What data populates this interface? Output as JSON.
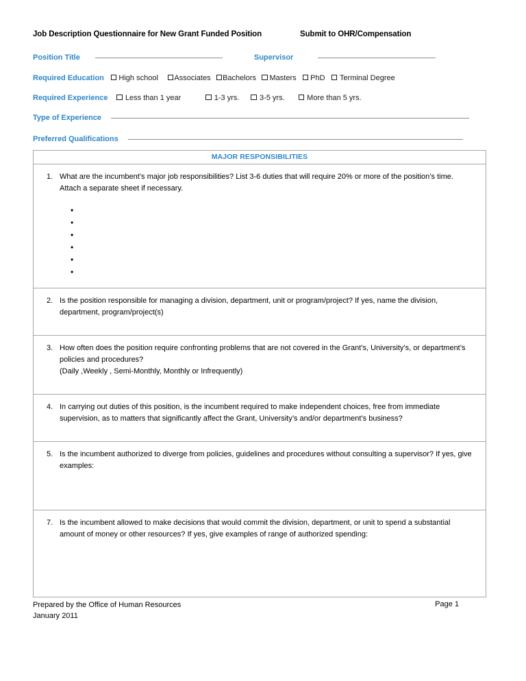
{
  "header": {
    "title": "Job Description Questionnaire for New Grant Funded Position",
    "submit_to": "Submit to OHR/Compensation"
  },
  "colors": {
    "label_blue": "#2E86C8",
    "table_border": "#a6a6a6",
    "rule_gray": "#8d8d8d"
  },
  "fields": {
    "position_title_label": "Position Title",
    "position_title_value": "",
    "supervisor_label": "Supervisor",
    "supervisor_value": "",
    "type_of_experience_label": "Type of Experience",
    "type_of_experience_value": "",
    "preferred_qualifications_label": "Preferred Qualifications",
    "preferred_qualifications_value": ""
  },
  "required_education": {
    "label": "Required Education",
    "options": [
      {
        "label": "High school",
        "checked": false
      },
      {
        "label": "Associates",
        "checked": false
      },
      {
        "label": "Bachelors",
        "checked": false
      },
      {
        "label": "Masters",
        "checked": false
      },
      {
        "label": "PhD",
        "checked": false
      },
      {
        "label": "Terminal Degree",
        "checked": false
      }
    ]
  },
  "required_experience": {
    "label": "Required Experience",
    "options": [
      {
        "label": "Less than 1 year",
        "checked": false
      },
      {
        "label": "1-3 yrs.",
        "checked": false
      },
      {
        "label": "3-5 yrs.",
        "checked": false
      },
      {
        "label": "More than 5 yrs.",
        "checked": false
      }
    ]
  },
  "table": {
    "header": "MAJOR RESPONSIBILITIES",
    "questions": [
      {
        "number": "1.",
        "text": "What are the incumbent’s major job responsibilities?  List 3-6 duties that will require 20% or more of the position’s time.  Attach a separate sheet if necessary.",
        "sub": "",
        "bullets": [
          "",
          "",
          "",
          "",
          "",
          ""
        ],
        "answer": ""
      },
      {
        "number": "2.",
        "text": "Is the position responsible for managing a division, department, unit or program/project?  If yes, name the division, department, program/project(s)",
        "sub": "",
        "bullets": [],
        "answer": ""
      },
      {
        "number": "3.",
        "text": "How often does the position require confronting problems that are not covered in the Grant’s, University’s, or department’s policies and procedures?",
        "sub": "(Daily ,Weekly , Semi-Monthly, Monthly or Infrequently)",
        "bullets": [],
        "answer": ""
      },
      {
        "number": "4.",
        "text": "In carrying out duties of this position, is the incumbent required to make independent choices, free from immediate supervision, as to matters that significantly affect the Grant, University’s and/or department’s business?",
        "sub": "",
        "bullets": [],
        "answer": ""
      },
      {
        "number": "5.",
        "text": "Is the incumbent authorized to diverge from policies, guidelines and procedures without consulting a supervisor?  If yes, give examples:",
        "sub": "",
        "bullets": [],
        "answer": ""
      },
      {
        "number": "7.",
        "text": "Is the incumbent allowed to make decisions that would commit the division, department, or unit to spend a substantial amount of money or other resources? If yes, give examples of range of authorized spending:",
        "sub": "",
        "bullets": [],
        "answer": ""
      }
    ]
  },
  "footer": {
    "prepared_by": "Prepared by the Office of Human Resources",
    "date": "January 2011",
    "page": "Page 1"
  }
}
